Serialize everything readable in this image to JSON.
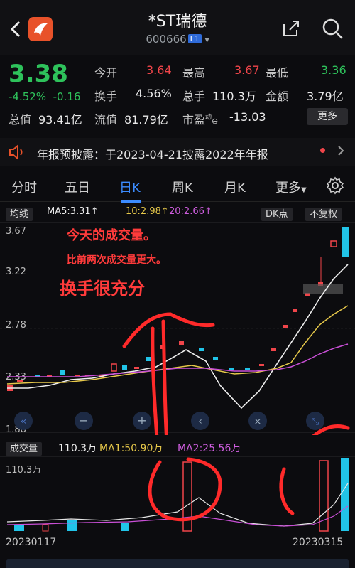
{
  "header": {
    "title": "*ST瑞德",
    "code": "600666",
    "level_badge": "L1",
    "level_caret": "▾"
  },
  "quote": {
    "price": "3.38",
    "change_pct": "-4.52%",
    "change": "-0.16",
    "open_label": "今开",
    "open": "3.64",
    "high_label": "最高",
    "high": "3.67",
    "low_label": "最低",
    "low": "3.36",
    "turnover_label": "换手",
    "turnover": "4.56%",
    "volume_label": "总手",
    "volume": "110.3万",
    "amount_label": "金额",
    "amount": "3.79亿",
    "mktcap_label": "总值",
    "mktcap": "93.41亿",
    "float_label": "流值",
    "float_cap": "81.79亿",
    "pe_label": "市盈",
    "pe_sup": "动",
    "pe": "-13.03",
    "more_label": "更多"
  },
  "notice": {
    "text": "年报预披露：于2023-04-21披露2022年年报"
  },
  "tabs": [
    "分时",
    "五日",
    "日K",
    "周K",
    "月K",
    "更多"
  ],
  "chart": {
    "ma_label": "均线",
    "ma5": "MA5:3.31↑",
    "ma10": "10:2.98↑",
    "ma20": "20:2.66↑",
    "dk_label": "DK点",
    "adjust_label": "不复权",
    "y_ticks": [
      "3.67",
      "3.22",
      "2.78",
      "2.33",
      "1.88"
    ],
    "annotations": [
      "今天的成交量。",
      "比前两次成交量更大。",
      "换手很充分"
    ],
    "vol_label": "成交量",
    "vol_value": "110.3万",
    "vol_ma1": "MA1:50.90万",
    "vol_ma2": "MA2:25.56万",
    "vol_max": "110.3万",
    "date_start": "20230117",
    "date_end": "20230315",
    "colors": {
      "up": "#f0454a",
      "down": "#21c4e8",
      "ma5": "#ffffff",
      "ma10": "#e6c84a",
      "ma20": "#c94fd6"
    }
  }
}
